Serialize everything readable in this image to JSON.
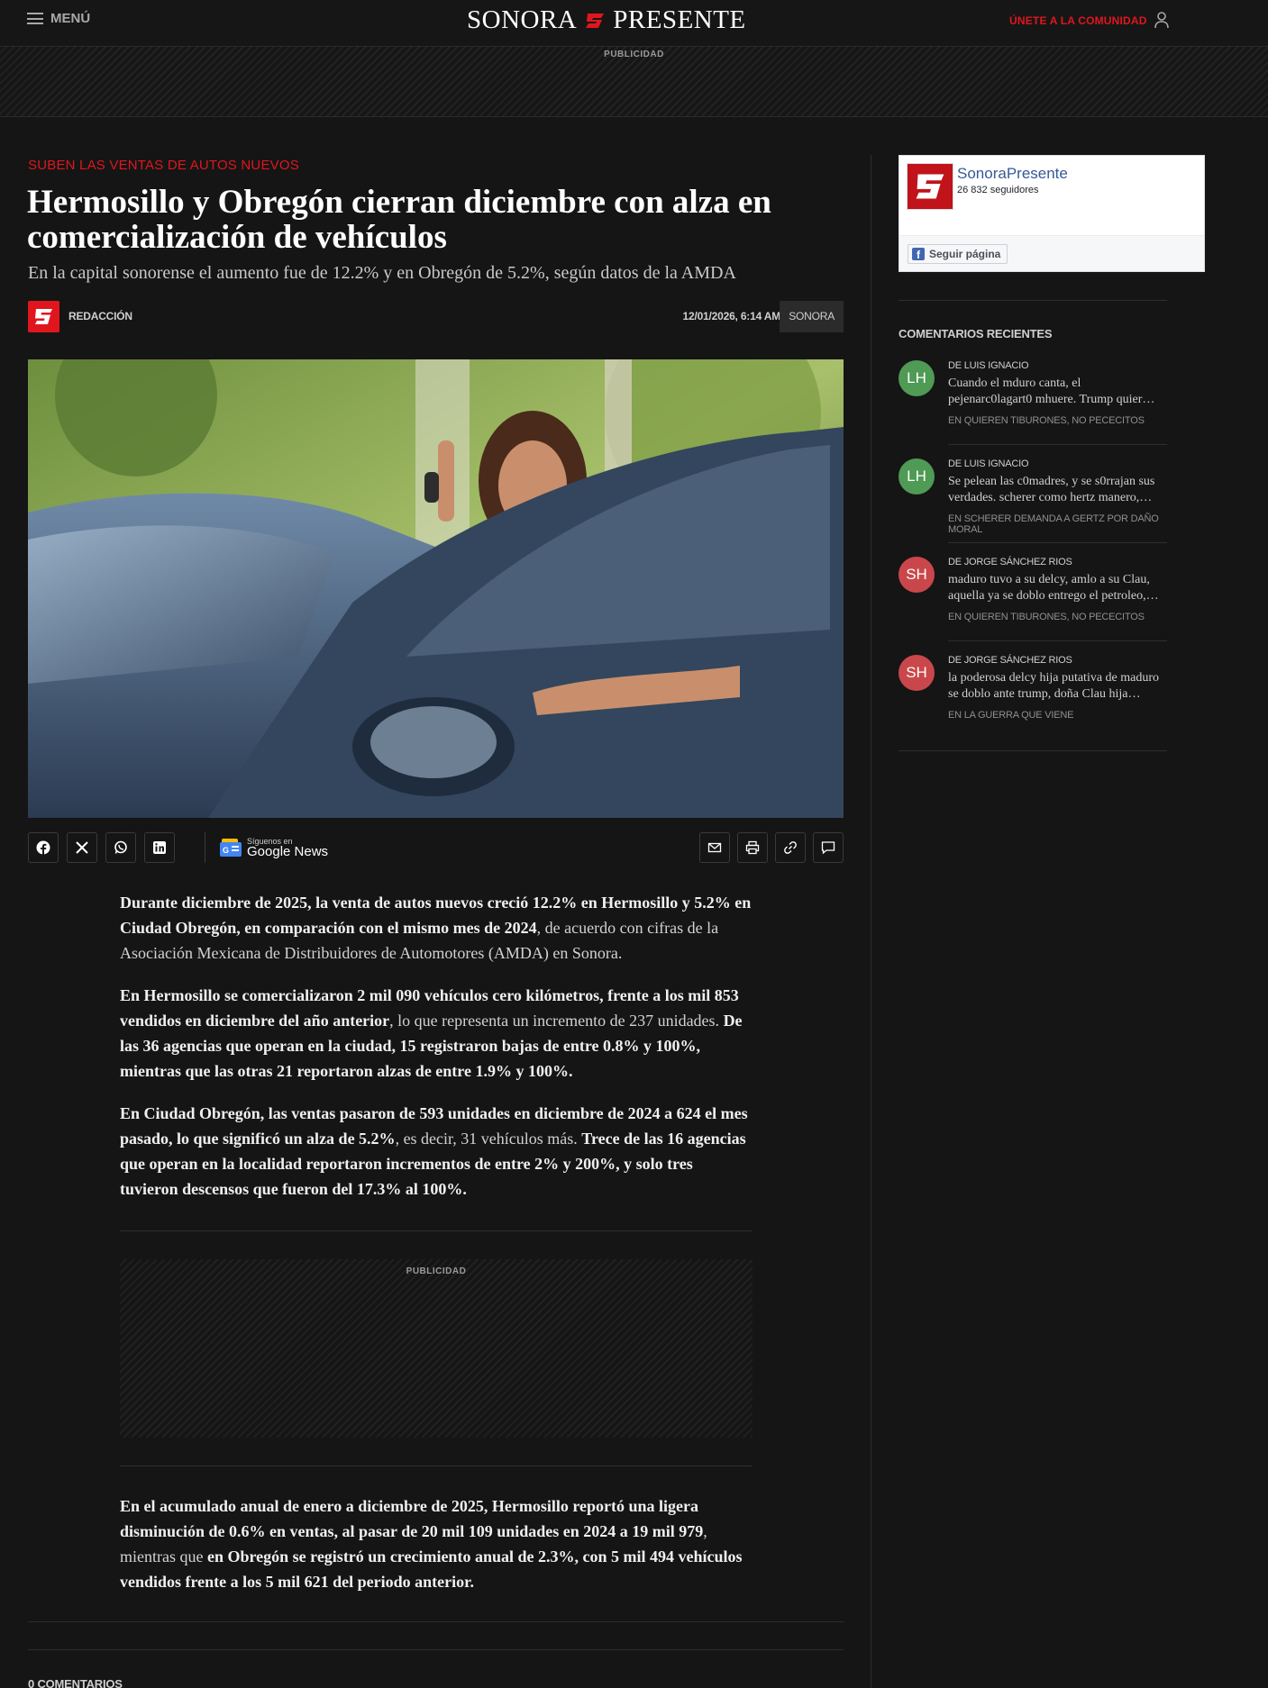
{
  "header": {
    "menu_label": "MENÚ",
    "logo_left": "SONORA",
    "logo_right": "PRESENTE",
    "join_label": "ÚNETE A LA COMUNIDAD",
    "ad_label": "PUBLICIDAD"
  },
  "article": {
    "kicker": "SUBEN LAS VENTAS DE AUTOS NUEVOS",
    "title": "Hermosillo y Obregón cierran diciembre con alza en comercialización de vehículos",
    "subtitle": "En la capital sonorense el aumento fue de 12.2% y en Obregón de 5.2%, según datos de la AMDA",
    "author": "REDACCIÓN",
    "date": "12/01/2026, 6:14 AM",
    "section_tag": "SONORA",
    "google_news_small": "Síguenos en",
    "google_news_big": "Google News",
    "share_icons": [
      "facebook-icon",
      "x-icon",
      "whatsapp-icon",
      "linkedin-icon"
    ],
    "tool_icons": [
      "mail-icon",
      "print-icon",
      "link-icon",
      "comment-icon"
    ],
    "p1_b": "Durante diciembre de 2025, la venta de autos nuevos creció 12.2% en Hermosillo y 5.2% en Ciudad Obregón, en comparación con el mismo mes de 2024",
    "p1_n": ", de acuerdo con cifras de la Asociación Mexicana de Distribuidores de Automotores (AMDA) en Sonora.",
    "p2_b1": "En Hermosillo se comercializaron 2 mil 090 vehículos cero kilómetros, frente a los mil 853 vendidos en diciembre del año anterior",
    "p2_n": ", lo que representa un incremento de 237 unidades. ",
    "p2_b2": "De las 36 agencias que operan en la ciudad, 15 registraron bajas de entre 0.8% y 100%, mientras que las otras 21 reportaron alzas de entre 1.9% y 100%.",
    "p3_b1": "En Ciudad Obregón, las ventas pasaron de 593 unidades en diciembre de 2024 a 624 el mes pasado, lo que significó un alza de 5.2%",
    "p3_n": ", es decir, 31 vehículos más. ",
    "p3_b2": "Trece de las 16 agencias que operan en la localidad reportaron incrementos de entre 2% y 200%, y solo tres tuvieron descensos que fueron del 17.3% al 100%.",
    "ad_label": "PUBLICIDAD",
    "p4_b1": "En el acumulado anual de enero a diciembre de 2025, Hermosillo reportó una ligera disminución de 0.6% en ventas, al pasar de 20 mil 109 unidades en 2024 a 19 mil 979",
    "p4_n": ", mientras que ",
    "p4_b2": "en Obregón se registró un crecimiento anual de 2.3%, con 5 mil 494 vehículos vendidos frente a los 5 mil 621 del periodo anterior.",
    "comments_title": "0 COMENTARIOS"
  },
  "sidebar": {
    "fb_name": "SonoraPresente",
    "fb_followers": "26 832 seguidores",
    "fb_button": "Seguir página",
    "recent_title": "COMENTARIOS RECIENTES",
    "comments": [
      {
        "initials": "LH",
        "color": "#4f9a55",
        "author": "DE LUIS IGNACIO",
        "text": "Cuando el mduro canta, el pejenarc0lagart0 mhuere. Trump quier…",
        "post": "EN QUIEREN TIBURONES, NO PECECITOS"
      },
      {
        "initials": "LH",
        "color": "#4f9a55",
        "author": "DE LUIS IGNACIO",
        "text": "Se pelean las c0madres, y se s0rrajan sus verdades. scherer como hertz manero,…",
        "post": "EN SCHERER DEMANDA A GERTZ POR DAÑO MORAL"
      },
      {
        "initials": "SH",
        "color": "#c9474a",
        "author": "DE JORGE SÁNCHEZ RIOS",
        "text": "maduro tuvo a su delcy, amlo a su Clau, aquella ya se doblo entrego el petroleo,…",
        "post": "EN QUIEREN TIBURONES, NO PECECITOS"
      },
      {
        "initials": "SH",
        "color": "#c9474a",
        "author": "DE JORGE SÁNCHEZ RIOS",
        "text": "la poderosa delcy hija putativa de maduro se doblo ante trump, doña Clau hija…",
        "post": "EN LA GUERRA QUE VIENE"
      }
    ]
  },
  "colors": {
    "accent": "#e0161e",
    "background": "#151515",
    "fb_link": "#365899"
  }
}
